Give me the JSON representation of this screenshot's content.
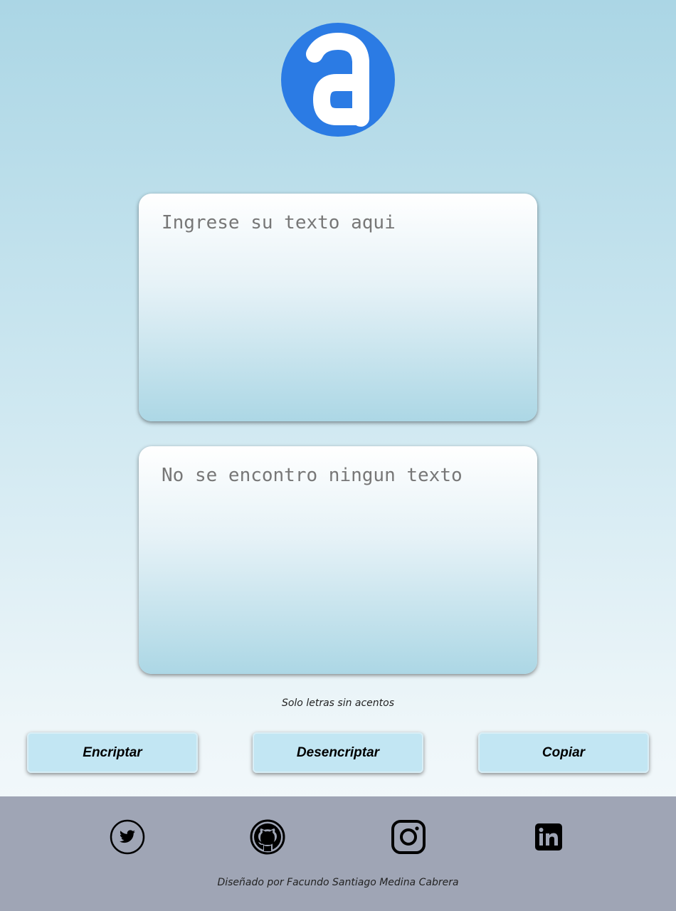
{
  "logo": {
    "icon": "letter-a-icon",
    "color": "#2b7be4"
  },
  "input": {
    "placeholder": "Ingrese su texto aqui"
  },
  "output": {
    "placeholder": "No se encontro ningun texto"
  },
  "hint": "Solo letras sin acentos",
  "buttons": {
    "encrypt": "Encriptar",
    "decrypt": "Desencriptar",
    "copy": "Copiar"
  },
  "footer": {
    "social": [
      {
        "name": "twitter",
        "icon": "twitter-icon"
      },
      {
        "name": "github",
        "icon": "github-icon"
      },
      {
        "name": "instagram",
        "icon": "instagram-icon"
      },
      {
        "name": "linkedin",
        "icon": "linkedin-icon"
      }
    ],
    "credit": "Diseñado por Facundo Santiago Medina Cabrera"
  },
  "colors": {
    "button_bg": "#c2e6f3",
    "footer_bg": "#9fa5b5",
    "placeholder": "#777777"
  }
}
